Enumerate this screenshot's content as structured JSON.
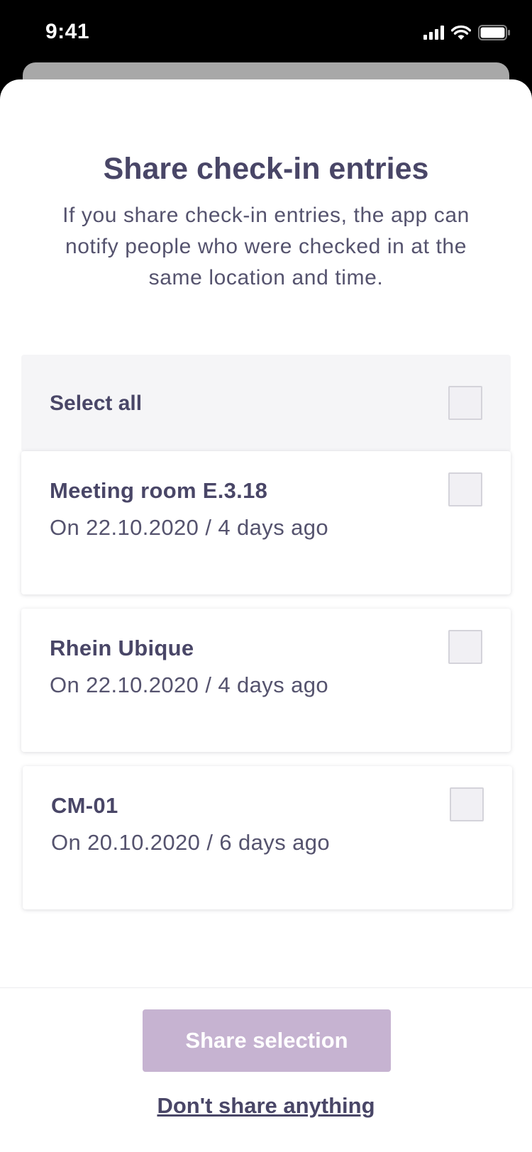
{
  "status_bar": {
    "time": "9:41"
  },
  "sheet": {
    "title": "Share check-in entries",
    "subtitle": "If you share check-in entries, the app can notify people who were checked in at the same location and time."
  },
  "select_all": {
    "label": "Select all",
    "checked": false
  },
  "entries": [
    {
      "name": "Meeting room E.3.18",
      "date": "On 22.10.2020 / 4 days ago",
      "checked": false
    },
    {
      "name": "Rhein Ubique",
      "date": "On 22.10.2020 / 4 days ago",
      "checked": false
    },
    {
      "name": "CM-01",
      "date": "On 20.10.2020 / 6 days ago",
      "checked": false
    }
  ],
  "footer": {
    "share_label": "Share selection",
    "dont_share_label": "Don't share anything"
  },
  "colors": {
    "text_primary": "#494667",
    "button_disabled": "#c6b3d1",
    "select_all_bg": "#f5f5f7"
  }
}
